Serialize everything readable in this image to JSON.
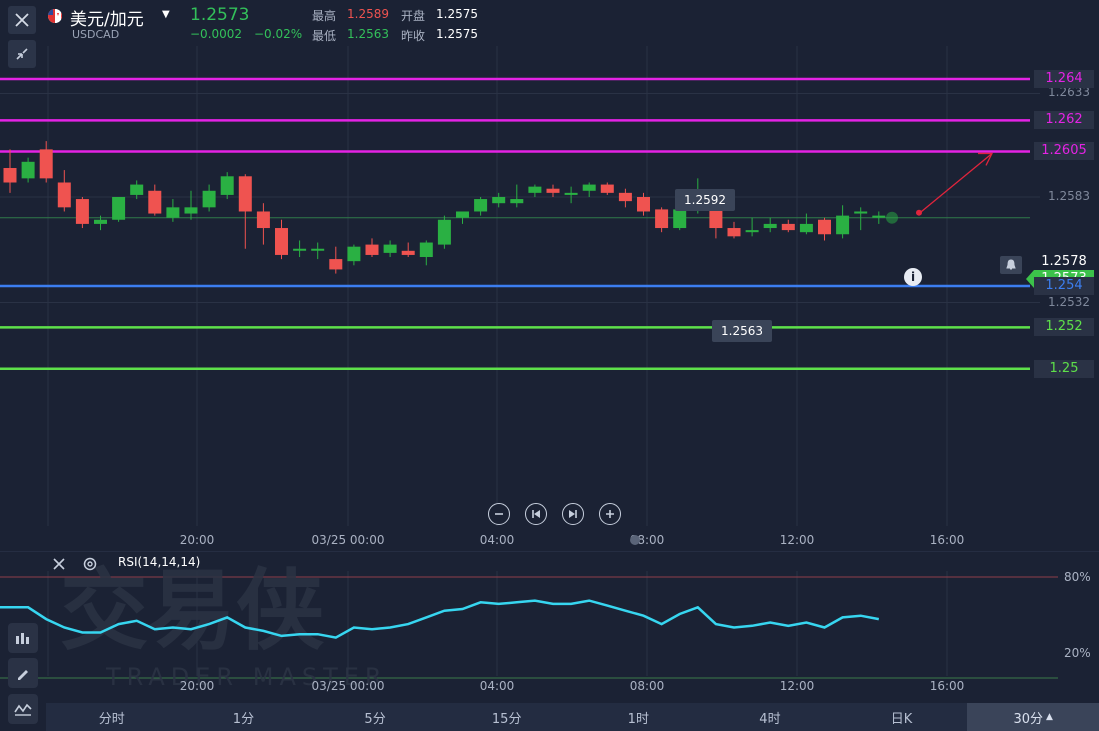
{
  "header": {
    "symbol_name": "美元/加元",
    "symbol_code": "USDCAD",
    "last_price": "1.2573",
    "change": "−0.0002",
    "change_pct": "−0.02%",
    "high_label": "最高",
    "high_value": "1.2589",
    "low_label": "最低",
    "low_value": "1.2563",
    "open_label": "开盘",
    "open_value": "1.2575",
    "prev_close_label": "昨收",
    "prev_close_value": "1.2575",
    "colors": {
      "up": "#33c05a",
      "down": "#ef5350",
      "neutral": "#ffffff"
    }
  },
  "price_axis": {
    "ticks": [
      "1.2633",
      "1.2583",
      "1.2532"
    ]
  },
  "levels": [
    {
      "label": "1.264",
      "value": 1.264,
      "color": "#e423e4"
    },
    {
      "label": "1.262",
      "value": 1.262,
      "color": "#e423e4"
    },
    {
      "label": "1.2605",
      "value": 1.2605,
      "color": "#e423e4"
    },
    {
      "label": "1.254",
      "value": 1.254,
      "color": "#3c7ef0"
    },
    {
      "label": "1.252",
      "value": 1.252,
      "color": "#5ee04a"
    },
    {
      "label": "1.25",
      "value": 1.25,
      "color": "#5ee04a"
    }
  ],
  "markers": {
    "current_white": "1.2578",
    "current_green": "1.2573",
    "high_callout": "1.2592",
    "low_callout": "1.2563"
  },
  "time_axis": {
    "labels": [
      "20:00",
      "03/25 00:00",
      "04:00",
      "08:00",
      "12:00",
      "16:00"
    ]
  },
  "rsi": {
    "title": "RSI(14,14,14)",
    "upper_label": "80%",
    "lower_label": "20%",
    "line_color": "#37d6f0"
  },
  "watermark": {
    "cn": "交易侠",
    "en": "TRADER MASTER"
  },
  "chart_data": {
    "type": "candlestick",
    "symbol": "USDCAD",
    "candles": [
      {
        "o": 1.2597,
        "h": 1.2606,
        "c": 1.259,
        "l": 1.2585
      },
      {
        "o": 1.2592,
        "h": 1.2602,
        "c": 1.26,
        "l": 1.259
      },
      {
        "o": 1.2606,
        "h": 1.261,
        "c": 1.2592,
        "l": 1.259
      },
      {
        "o": 1.259,
        "h": 1.2596,
        "c": 1.2578,
        "l": 1.2576
      },
      {
        "o": 1.2582,
        "h": 1.2583,
        "c": 1.257,
        "l": 1.2568
      },
      {
        "o": 1.257,
        "h": 1.2574,
        "c": 1.2572,
        "l": 1.2567
      },
      {
        "o": 1.2572,
        "h": 1.2576,
        "c": 1.2583,
        "l": 1.2571
      },
      {
        "o": 1.2584,
        "h": 1.2591,
        "c": 1.2589,
        "l": 1.2582
      },
      {
        "o": 1.2586,
        "h": 1.2589,
        "c": 1.2575,
        "l": 1.2574
      },
      {
        "o": 1.2573,
        "h": 1.2582,
        "c": 1.2578,
        "l": 1.2571
      },
      {
        "o": 1.2575,
        "h": 1.2586,
        "c": 1.2578,
        "l": 1.2572
      },
      {
        "o": 1.2578,
        "h": 1.2589,
        "c": 1.2586,
        "l": 1.2576
      },
      {
        "o": 1.2584,
        "h": 1.2595,
        "c": 1.2593,
        "l": 1.2582
      },
      {
        "o": 1.2593,
        "h": 1.2594,
        "c": 1.2576,
        "l": 1.2558
      },
      {
        "o": 1.2576,
        "h": 1.258,
        "c": 1.2568,
        "l": 1.256
      },
      {
        "o": 1.2568,
        "h": 1.2572,
        "c": 1.2555,
        "l": 1.2553
      },
      {
        "o": 1.2558,
        "h": 1.2562,
        "c": 1.2558,
        "l": 1.2554
      },
      {
        "o": 1.2558,
        "h": 1.2561,
        "c": 1.2558,
        "l": 1.2553
      },
      {
        "o": 1.2553,
        "h": 1.2559,
        "c": 1.2548,
        "l": 1.2546
      },
      {
        "o": 1.2552,
        "h": 1.256,
        "c": 1.2559,
        "l": 1.255
      },
      {
        "o": 1.256,
        "h": 1.2563,
        "c": 1.2555,
        "l": 1.2554
      },
      {
        "o": 1.2556,
        "h": 1.2562,
        "c": 1.256,
        "l": 1.2554
      },
      {
        "o": 1.2557,
        "h": 1.2561,
        "c": 1.2555,
        "l": 1.2554
      },
      {
        "o": 1.2554,
        "h": 1.2562,
        "c": 1.2561,
        "l": 1.255
      },
      {
        "o": 1.256,
        "h": 1.2574,
        "c": 1.2572,
        "l": 1.2558
      },
      {
        "o": 1.2573,
        "h": 1.2576,
        "c": 1.2576,
        "l": 1.257
      },
      {
        "o": 1.2576,
        "h": 1.2583,
        "c": 1.2582,
        "l": 1.2574
      },
      {
        "o": 1.258,
        "h": 1.2585,
        "c": 1.2583,
        "l": 1.2578
      },
      {
        "o": 1.258,
        "h": 1.2589,
        "c": 1.2582,
        "l": 1.2578
      },
      {
        "o": 1.2585,
        "h": 1.2589,
        "c": 1.2588,
        "l": 1.2583
      },
      {
        "o": 1.2587,
        "h": 1.2589,
        "c": 1.2585,
        "l": 1.2583
      },
      {
        "o": 1.2584,
        "h": 1.2588,
        "c": 1.2585,
        "l": 1.258
      },
      {
        "o": 1.2586,
        "h": 1.259,
        "c": 1.2589,
        "l": 1.2583
      },
      {
        "o": 1.2589,
        "h": 1.259,
        "c": 1.2585,
        "l": 1.2584
      },
      {
        "o": 1.2585,
        "h": 1.2587,
        "c": 1.2581,
        "l": 1.2578
      },
      {
        "o": 1.2583,
        "h": 1.2585,
        "c": 1.2576,
        "l": 1.2574
      },
      {
        "o": 1.2577,
        "h": 1.2578,
        "c": 1.2568,
        "l": 1.2566
      },
      {
        "o": 1.2568,
        "h": 1.2583,
        "c": 1.2577,
        "l": 1.2567
      },
      {
        "o": 1.2577,
        "h": 1.2592,
        "c": 1.2584,
        "l": 1.2575
      },
      {
        "o": 1.2584,
        "h": 1.2585,
        "c": 1.2568,
        "l": 1.2563
      },
      {
        "o": 1.2568,
        "h": 1.2571,
        "c": 1.2564,
        "l": 1.2563
      },
      {
        "o": 1.2566,
        "h": 1.2573,
        "c": 1.2567,
        "l": 1.2564
      },
      {
        "o": 1.2568,
        "h": 1.2573,
        "c": 1.257,
        "l": 1.2566
      },
      {
        "o": 1.257,
        "h": 1.2572,
        "c": 1.2567,
        "l": 1.2566
      },
      {
        "o": 1.2566,
        "h": 1.2575,
        "c": 1.257,
        "l": 1.2565
      },
      {
        "o": 1.2572,
        "h": 1.2573,
        "c": 1.2565,
        "l": 1.2562
      },
      {
        "o": 1.2565,
        "h": 1.2579,
        "c": 1.2574,
        "l": 1.2563
      },
      {
        "o": 1.2575,
        "h": 1.2578,
        "c": 1.2576,
        "l": 1.2567
      },
      {
        "o": 1.2573,
        "h": 1.2576,
        "c": 1.2574,
        "l": 1.257
      }
    ],
    "rsi_values": [
      62,
      62,
      55,
      50,
      47,
      47,
      52,
      54,
      49,
      50,
      49,
      52,
      56,
      50,
      48,
      45,
      46,
      46,
      44,
      50,
      49,
      50,
      52,
      56,
      60,
      61,
      65,
      64,
      65,
      66,
      64,
      64,
      66,
      63,
      60,
      57,
      52,
      58,
      62,
      52,
      50,
      51,
      53,
      51,
      53,
      50,
      56,
      57,
      55
    ]
  },
  "toolbar": {
    "periods": [
      "分时",
      "1分",
      "5分",
      "15分",
      "1时",
      "4时",
      "日K",
      "30分"
    ],
    "active_period": "30分"
  }
}
